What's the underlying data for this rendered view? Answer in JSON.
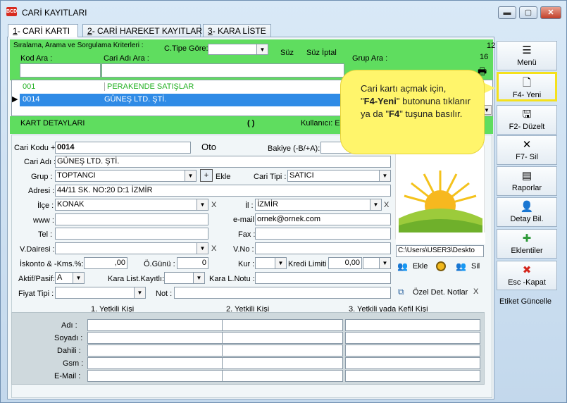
{
  "window": {
    "title": "CARİ KAYITLARI",
    "app_icon_text": "BCD",
    "min_glyph": "▬",
    "max_glyph": "▢",
    "close_glyph": "✕"
  },
  "tabs": [
    {
      "num": "1",
      "label": "- CARİ KARTI"
    },
    {
      "num": "2",
      "label": "- CARİ HAREKET KAYITLARI"
    },
    {
      "num": "3",
      "label": "- KARA LİSTE"
    }
  ],
  "search": {
    "criteria_label": "Sıralama, Arama ve Sorgulama Kriterleri :",
    "kod_ara_label": "Kod Ara :",
    "cari_adi_ara_label": "Cari Adı Ara :",
    "c_tipe_gore_label": "C.Tipe Göre:",
    "suz_label": "Süz",
    "suz_iptal_label": "Süz İptal",
    "grup_ara_label": "Grup Ara :",
    "count_top": "12",
    "count_bottom": "16"
  },
  "list": {
    "rows": [
      {
        "code": "001",
        "name": "PERAKENDE SATIŞLAR",
        "selected": false
      },
      {
        "code": "0014",
        "name": "GÜNEŞ LTD. ŞTİ.",
        "selected": true
      }
    ],
    "pointer_glyph": "▶"
  },
  "detail_bar": {
    "title": "KART DETAYLARI",
    "spinner": "( )",
    "user_label": "Kullanıcı: EK"
  },
  "form": {
    "cari_kodu_label": "Cari Kodu +",
    "cari_kodu": "0014",
    "oto": "Oto",
    "bakiye_label": "Bakiye (-B/+A):",
    "cari_adi_label": "Cari Adı :",
    "cari_adi": "GÜNEŞ LTD. ŞTİ.",
    "grup_label": "Grup :",
    "grup": "TOPTANCI",
    "ekle_label": "Ekle",
    "cari_tipi_label": "Cari Tipi :",
    "cari_tipi": "SATICI",
    "adres_label": "Adresi :",
    "adres": "44/11 SK. NO:20 D:1 İZMİR",
    "ilce_label": "İlçe :",
    "ilce": "KONAK",
    "il_label": "İl :",
    "il": "İZMİR",
    "www_label": "www :",
    "email_label": "e-mail:",
    "email": "ornek@ornek.com",
    "tel_label": "Tel :",
    "fax_label": "Fax :",
    "vdairesi_label": "V.Dairesi :",
    "vno_label": "V.No :",
    "iskonto_label": "İskonto & -Kms.%:",
    "iskonto": ",00",
    "ogunu_label": "Ö.Günü :",
    "ogunu": "0",
    "kur_label": "Kur :",
    "kredi_label": "Kredi Limiti :",
    "kredi": "0,00",
    "aktif_label": "Aktif/Pasif:",
    "aktif": "A",
    "kara_list_label": "Kara List.Kayıtlı:",
    "kara_notu_label": "Kara L.Notu :",
    "fiyat_tipi_label": "Fiyat Tipi :",
    "not_label": "Not :",
    "image_path": "C:\\Users\\USER3\\Deskto",
    "img_ekle": "Ekle",
    "img_sil": "Sil",
    "ozel_det_label": "Özel Det. Notlar",
    "x_glyph": "X"
  },
  "contacts": {
    "col1": "1. Yetkili Kişi",
    "col2": "2. Yetkili Kişi",
    "col3": "3. Yetkili yada Kefil Kişi",
    "rows": [
      "Adı :",
      "Soyadı :",
      "Dahili :",
      "Gsm :",
      "E-Mail :"
    ]
  },
  "sidebar": {
    "buttons": [
      {
        "label": "Menü",
        "icon": "menu-icon",
        "glyph": "☰"
      },
      {
        "label": "F4- Yeni",
        "icon": "new-document-icon",
        "glyph": "🗋"
      },
      {
        "label": "F2- Düzelt",
        "icon": "save-icon",
        "glyph": "🖫"
      },
      {
        "label": "F7- Sil",
        "icon": "delete-x-icon",
        "glyph": "✕"
      },
      {
        "label": "Raporlar",
        "icon": "report-icon",
        "glyph": "▤"
      },
      {
        "label": "Detay Bil.",
        "icon": "detail-user-icon",
        "glyph": "👤"
      },
      {
        "label": "Eklentiler",
        "icon": "add-ons-icon",
        "glyph": "✚"
      },
      {
        "label": "Esc -Kapat",
        "icon": "close-red-icon",
        "glyph": "✖"
      }
    ],
    "etiket": "Etiket Güncelle"
  },
  "tooltip": {
    "line1": "Cari kartı açmak için,",
    "quote1": "\"",
    "bold1": "F4-Yeni",
    "quote2": "\"",
    "line2": " butonuna tıklanır ya da \"",
    "bold2": "F4",
    "line3": "\" tuşuna basılır."
  },
  "colors": {
    "green_panel": "#5fdd5f",
    "selection_blue": "#2f8be6",
    "list_green_text": "#22b022",
    "tooltip_yellow": "#fff56b",
    "highlight_border": "#f5e11c"
  }
}
